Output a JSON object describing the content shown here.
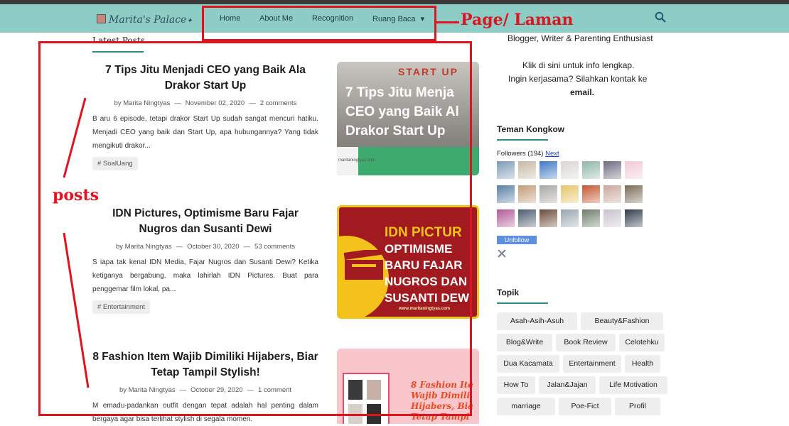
{
  "nav": {
    "logo": "Marita's Palace",
    "items": [
      "Home",
      "About Me",
      "Recognition",
      "Ruang Baca"
    ],
    "dropdown_caret": "▾"
  },
  "annotations": {
    "page_label": "Page/  Laman",
    "posts_label": "posts",
    "color": "#e0141e"
  },
  "main": {
    "section_title": "Latest Posts",
    "posts": [
      {
        "title": "7 Tips Jitu Menjadi CEO yang Baik Ala Drakor Start Up",
        "author": "by Marita Ningtyas",
        "date": "November 02, 2020",
        "comments": "2 comments",
        "snippet": "B aru 6 episode, tetapi drakor Start Up sudah sangat mencuri hatiku. Menjadi CEO yang baik dan Start Up, apa hubungannya? Yang tidak mengikuti drakor...",
        "tag": "# SoalUang",
        "thumb_lines": [
          "7 Tips Jitu Menja",
          "CEO yang Baik Al",
          "Drakor Start Up"
        ],
        "thumb_header": "START UP",
        "thumb_url": "maritaningtyas.com"
      },
      {
        "title": "IDN Pictures, Optimisme Baru Fajar Nugros dan Susanti Dewi",
        "author": "by Marita Ningtyas",
        "date": "October 30, 2020",
        "comments": "53 comments",
        "snippet": "S iapa tak kenal IDN Media, Fajar Nugros dan Susanti Dewi? Ketika ketiganya bergabung, maka lahirlah IDN Pictures. Buat para penggemar film lokal, pa...",
        "tag": "# Entertainment",
        "thumb_lines": [
          "IDN PICTUR",
          "OPTIMISME",
          "BARU FAJAR",
          "NUGROS DAN",
          "SUSANTI DEW"
        ],
        "thumb_url": "www.maritaningtyas.com"
      },
      {
        "title": "8 Fashion Item Wajib Dimiliki Hijabers, Biar Tetap Tampil Stylish!",
        "author": "by Marita Ningtyas",
        "date": "October 29, 2020",
        "comments": "1 comment",
        "snippet": "M emadu-padankan outfit dengan tepat adalah hal penting dalam bergaya agar bisa terlihat stylish di segala momen.",
        "thumb_lines": [
          "8 Fashion Ite",
          "Wajib Dimili",
          "Hijabers, Bia",
          "Tetap Tampi"
        ]
      }
    ]
  },
  "sidebar": {
    "about_tagline": "Blogger, Writer & Parenting Enthusiast",
    "about_info": "Klik di sini untuk info lengkap.",
    "about_contact": "Ingin kerjasama? Silahkan kontak ke",
    "about_email": "email.",
    "followers_title": "Teman Kongkow",
    "followers_label": "Followers (194)",
    "followers_next": "Next",
    "unfollow_label": "Unfollow",
    "topics_title": "Topik",
    "topics": [
      [
        "Asah-Asih-Asuh",
        "Beauty&Fashion"
      ],
      [
        "Blog&Write",
        "Book Review",
        "Celotehku"
      ],
      [
        "Dua Kacamata",
        "Entertainment",
        "Health"
      ],
      [
        "How To",
        "Jalan&Jajan",
        "Life Motivation"
      ],
      [
        "marriage",
        "Poe-Fict",
        "Profil"
      ]
    ],
    "avatar_colors": [
      "#7d9bb5",
      "#c7b8a6",
      "#3f78c4",
      "#d9d6d1",
      "#8fb6a8",
      "#6c6a80",
      "#f1c9d6",
      "#5a7fa6",
      "#c49c78",
      "#a8a6a1",
      "#e6c46a",
      "#c4552e",
      "#caa69b",
      "#7a6b55",
      "#b25a9a",
      "#4b5c6e",
      "#6b4a3a",
      "#9aa6b2",
      "#6d7d6a",
      "#c8c2cf",
      "#2f3a4a"
    ]
  }
}
